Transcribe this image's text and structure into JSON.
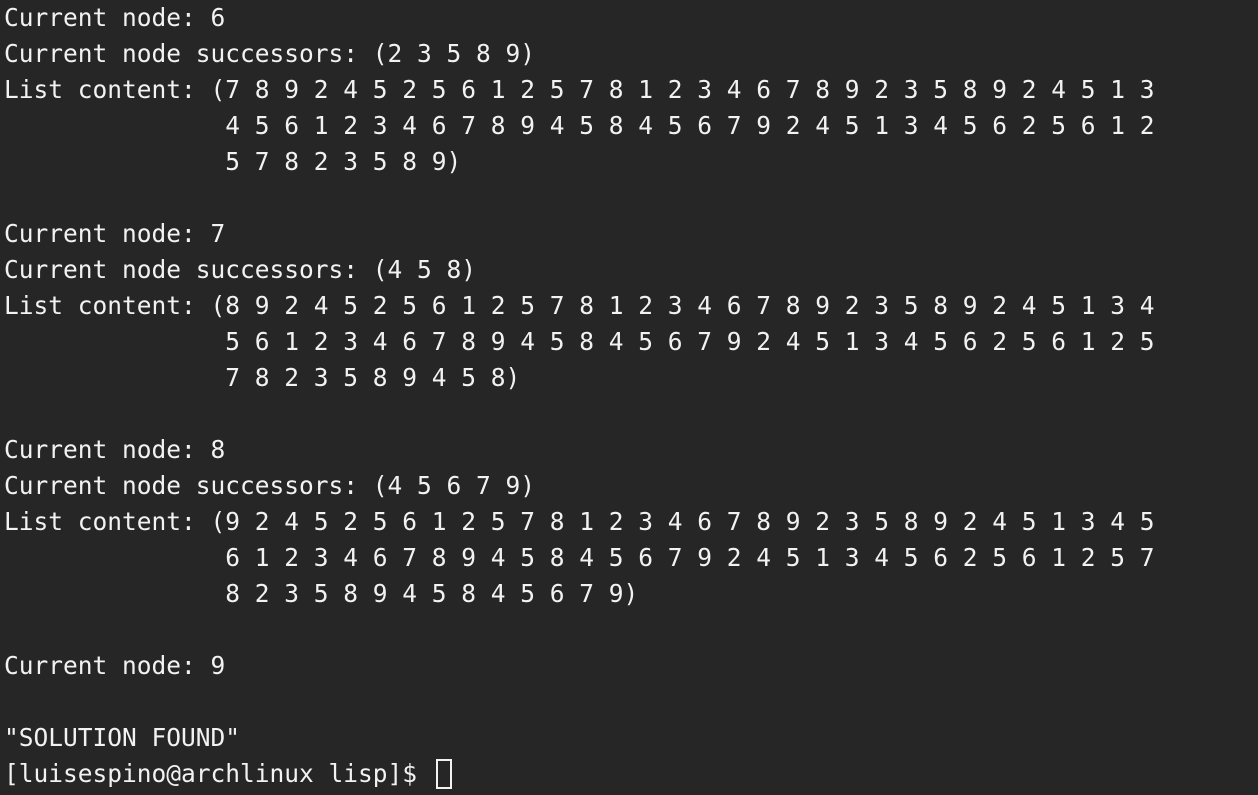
{
  "terminal": {
    "lines": [
      "Current node: 6",
      "Current node successors: (2 3 5 8 9)",
      "List content: (7 8 9 2 4 5 2 5 6 1 2 5 7 8 1 2 3 4 6 7 8 9 2 3 5 8 9 2 4 5 1 3",
      "               4 5 6 1 2 3 4 6 7 8 9 4 5 8 4 5 6 7 9 2 4 5 1 3 4 5 6 2 5 6 1 2",
      "               5 7 8 2 3 5 8 9)",
      "",
      "Current node: 7",
      "Current node successors: (4 5 8)",
      "List content: (8 9 2 4 5 2 5 6 1 2 5 7 8 1 2 3 4 6 7 8 9 2 3 5 8 9 2 4 5 1 3 4",
      "               5 6 1 2 3 4 6 7 8 9 4 5 8 4 5 6 7 9 2 4 5 1 3 4 5 6 2 5 6 1 2 5",
      "               7 8 2 3 5 8 9 4 5 8)",
      "",
      "Current node: 8",
      "Current node successors: (4 5 6 7 9)",
      "List content: (9 2 4 5 2 5 6 1 2 5 7 8 1 2 3 4 6 7 8 9 2 3 5 8 9 2 4 5 1 3 4 5",
      "               6 1 2 3 4 6 7 8 9 4 5 8 4 5 6 7 9 2 4 5 1 3 4 5 6 2 5 6 1 2 5 7",
      "               8 2 3 5 8 9 4 5 8 4 5 6 7 9)",
      "",
      "Current node: 9",
      "",
      "\"SOLUTION FOUND\""
    ],
    "prompt": "[luisespino@archlinux lisp]$ "
  },
  "colors": {
    "background": "#262626",
    "foreground": "#f2f2f2"
  }
}
